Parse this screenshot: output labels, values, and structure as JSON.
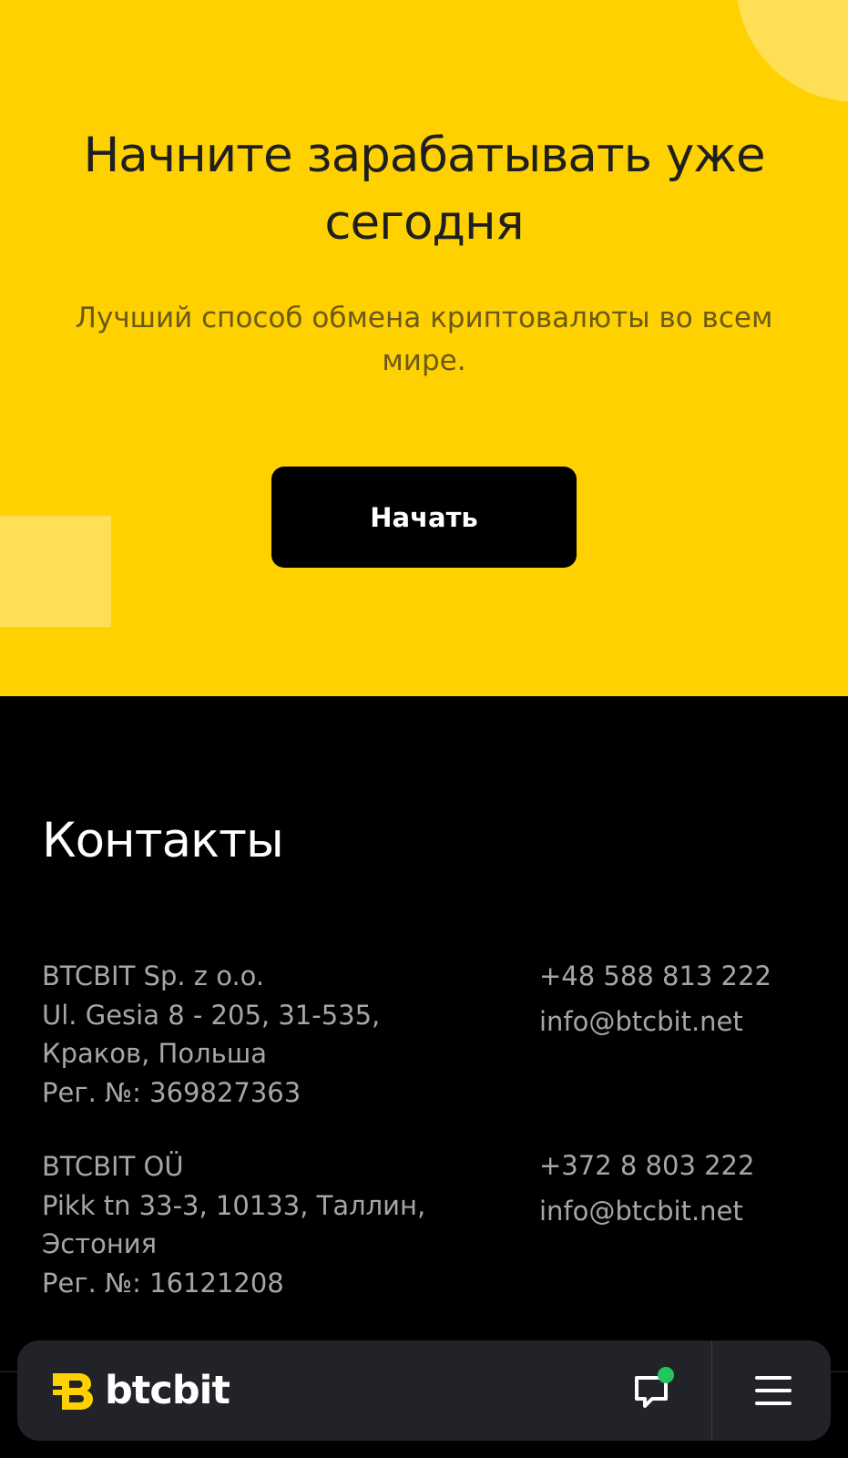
{
  "hero": {
    "title": "Начните зарабатывать уже сегодня",
    "subtitle": "Лучший способ обмена криптовалюты во всем мире.",
    "start_label": "Начать"
  },
  "contacts": {
    "title": "Контакты",
    "companies": [
      {
        "name": "BTCBIT Sp. z o.o.",
        "address_line1": "Ul. Gesia 8 - 205, 31-535,",
        "address_line2": "Краков, Польша",
        "reg": "Рег. №: 369827363",
        "phone": "+48 588 813 222",
        "email": "info@btcbit.net"
      },
      {
        "name": "BTCBIT OÜ",
        "address_line1": "Pikk tn 33-3, 10133, Таллин,",
        "address_line2": "Эстония",
        "reg": "Рег. №: 16121208",
        "phone": "+372 8 803 222",
        "email": "info@btcbit.net"
      }
    ]
  },
  "bottom_bar": {
    "logo_text": "btcbit",
    "icons": {
      "logo": "btcbit-logo-icon",
      "chat": "chat-icon",
      "menu": "hamburger-menu-icon"
    }
  },
  "colors": {
    "brand_yellow": "#FFD100",
    "deco_yellow": "#FFDF55",
    "bar_background": "#212328",
    "notification_green": "#22C55E"
  }
}
